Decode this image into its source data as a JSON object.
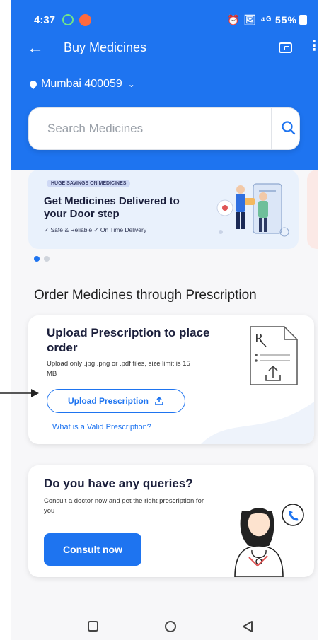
{
  "status_bar": {
    "time": "4:37",
    "right": "⏰ 🖼 ⁴ᴳ 55%"
  },
  "header": {
    "title": "Buy Medicines",
    "location": "Mumbai 400059"
  },
  "search": {
    "placeholder": "Search Medicines"
  },
  "banner": {
    "tag": "HUGE SAVINGS ON MEDICINES",
    "headline": "Get Medicines Delivered to your Door step",
    "features": "✓ Safe & Reliable   ✓ On Time Delivery"
  },
  "section_title": "Order Medicines through Prescription",
  "upload_card": {
    "title": "Upload Prescription to place order",
    "description": "Upload only .jpg .png or .pdf files, size limit is 15 MB",
    "button_label": "Upload Prescription",
    "link": "What is a Valid Prescription?"
  },
  "query_card": {
    "title": "Do you have any queries?",
    "description": "Consult a doctor now and get the right prescription for you",
    "button_label": "Consult now"
  },
  "colors": {
    "primary": "#1e74f0",
    "background": "#f7f7f9"
  }
}
